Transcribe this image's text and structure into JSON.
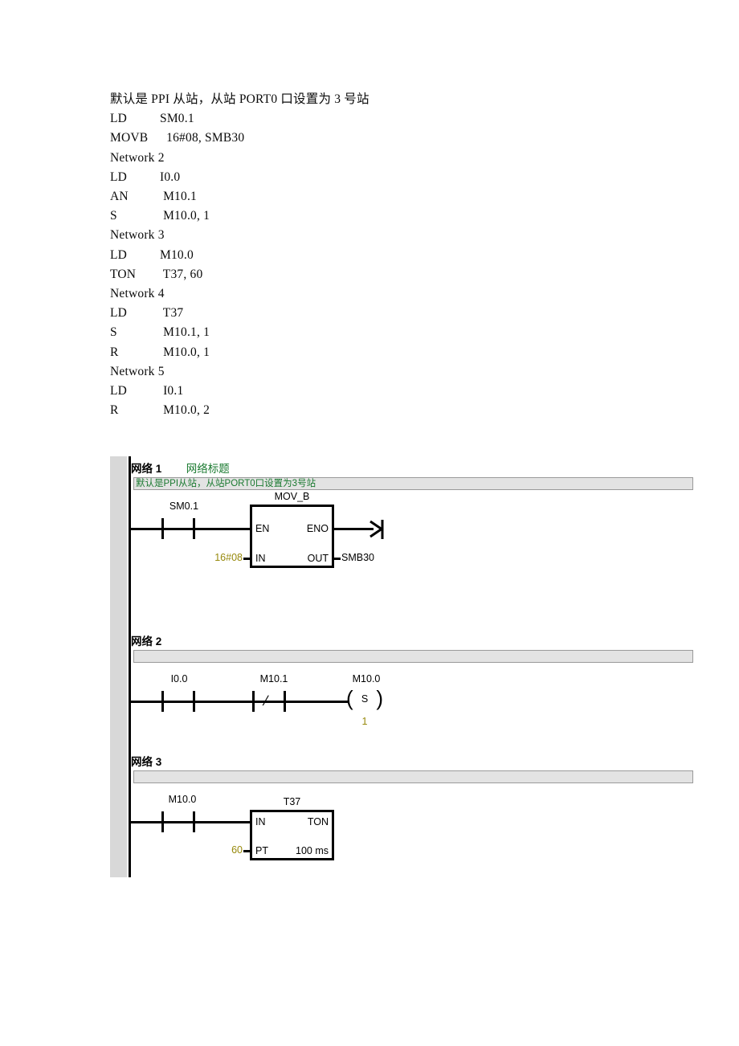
{
  "document": {
    "lines": [
      {
        "type": "cjk",
        "text": "默认是 PPI 从站，从站 PORT0 口设置为 3 号站"
      },
      {
        "type": "stl",
        "op": "LD",
        "operand": "SM0.1"
      },
      {
        "type": "stl",
        "op": "MOVB",
        "operand": "  16#08, SMB30"
      },
      {
        "type": "plain",
        "text": "Network 2"
      },
      {
        "type": "stl",
        "op": "LD",
        "operand": "I0.0"
      },
      {
        "type": "stl",
        "op": "AN",
        "operand": " M10.1"
      },
      {
        "type": "stl",
        "op": "S",
        "operand": " M10.0, 1"
      },
      {
        "type": "plain",
        "text": "Network 3"
      },
      {
        "type": "stl",
        "op": "LD",
        "operand": "M10.0"
      },
      {
        "type": "stl",
        "op": "TON",
        "operand": " T37, 60"
      },
      {
        "type": "plain",
        "text": "Network 4"
      },
      {
        "type": "stl",
        "op": "LD",
        "operand": " T37"
      },
      {
        "type": "stl",
        "op": "S",
        "operand": " M10.1, 1"
      },
      {
        "type": "stl",
        "op": "R",
        "operand": " M10.0, 1"
      },
      {
        "type": "plain",
        "text": "Network 5"
      },
      {
        "type": "stl",
        "op": "LD",
        "operand": " I0.1"
      },
      {
        "type": "stl",
        "op": "R",
        "operand": " M10.0, 2"
      }
    ]
  },
  "ladder": {
    "networks": [
      {
        "label": "网络 1",
        "title": "网络标题",
        "comment": "默认是PPI从站，从站PORT0口设置为3号站",
        "contacts": [
          {
            "operand": "SM0.1",
            "kind": "no"
          }
        ],
        "block": {
          "name": "MOV_B",
          "pin_in_top": "EN",
          "pin_out_top": "ENO",
          "pin_in_bottom": "IN",
          "pin_out_bottom": "OUT",
          "input_value": "16#08",
          "output_operand": "SMB30"
        },
        "end_symbol": "rung-continuation-arrow"
      },
      {
        "label": "网络 2",
        "title": "",
        "comment": "",
        "contacts": [
          {
            "operand": "I0.0",
            "kind": "no"
          },
          {
            "operand": "M10.1",
            "kind": "nc"
          }
        ],
        "coil": {
          "operand": "M10.0",
          "letter": "S",
          "count": "1"
        }
      },
      {
        "label": "网络 3",
        "title": "",
        "comment": "",
        "contacts": [
          {
            "operand": "M10.0",
            "kind": "no"
          }
        ],
        "block": {
          "name": "T37",
          "pin_in_top": "IN",
          "pin_out_top": "TON",
          "pin_in_bottom": "PT",
          "pin_out_bottom": "100 ms",
          "input_value": "60",
          "output_operand": ""
        }
      }
    ]
  },
  "colors": {
    "comment_text": "#1a7a30",
    "net_title": "#1a7a30",
    "constant": "#97890c",
    "comment_bar_bg": "#e3e3e3",
    "gutter_bg": "#d8d8d8",
    "rail": "#000000"
  }
}
